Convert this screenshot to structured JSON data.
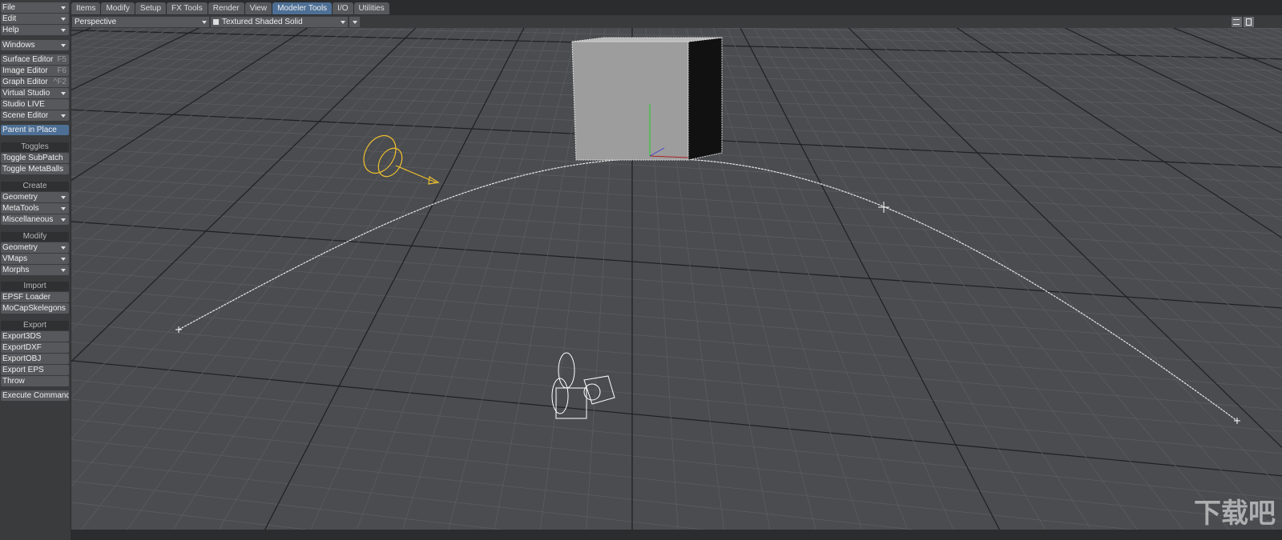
{
  "sidebar": {
    "menus": [
      {
        "label": "File"
      },
      {
        "label": "Edit"
      },
      {
        "label": "Help"
      },
      {
        "label": "Windows"
      }
    ],
    "windows": [
      {
        "label": "Surface Editor",
        "key": "F5"
      },
      {
        "label": "Image Editor",
        "key": "F6"
      },
      {
        "label": "Graph Editor",
        "key": "^F2"
      },
      {
        "label": "Virtual Studio"
      },
      {
        "label": "Studio LIVE"
      },
      {
        "label": "Scene Editor"
      }
    ],
    "parent_in_place": "Parent in Place",
    "toggles": {
      "title": "Toggles",
      "items": [
        "Toggle SubPatch",
        "Toggle MetaBalls"
      ]
    },
    "create": {
      "title": "Create",
      "items": [
        "Geometry",
        "MetaTools",
        "Miscellaneous"
      ]
    },
    "modify": {
      "title": "Modify",
      "items": [
        "Geometry",
        "VMaps",
        "Morphs"
      ]
    },
    "import": {
      "title": "Import",
      "items": [
        "EPSF Loader",
        "MoCapSkelegons"
      ]
    },
    "export": {
      "title": "Export",
      "items": [
        "Export3DS",
        "ExportDXF",
        "ExportOBJ",
        "Export EPS",
        "Throw"
      ]
    },
    "execute": "Execute Command"
  },
  "tabs": [
    {
      "label": "Items"
    },
    {
      "label": "Modify"
    },
    {
      "label": "Setup"
    },
    {
      "label": "FX Tools"
    },
    {
      "label": "Render"
    },
    {
      "label": "View"
    },
    {
      "label": "Modeler Tools",
      "active": true
    },
    {
      "label": "I/O"
    },
    {
      "label": "Utilities"
    }
  ],
  "viewport": {
    "view": "Perspective",
    "shading": "Textured Shaded Solid",
    "icons": [
      "list-icon",
      "save-icon"
    ]
  },
  "watermark": "下载吧"
}
